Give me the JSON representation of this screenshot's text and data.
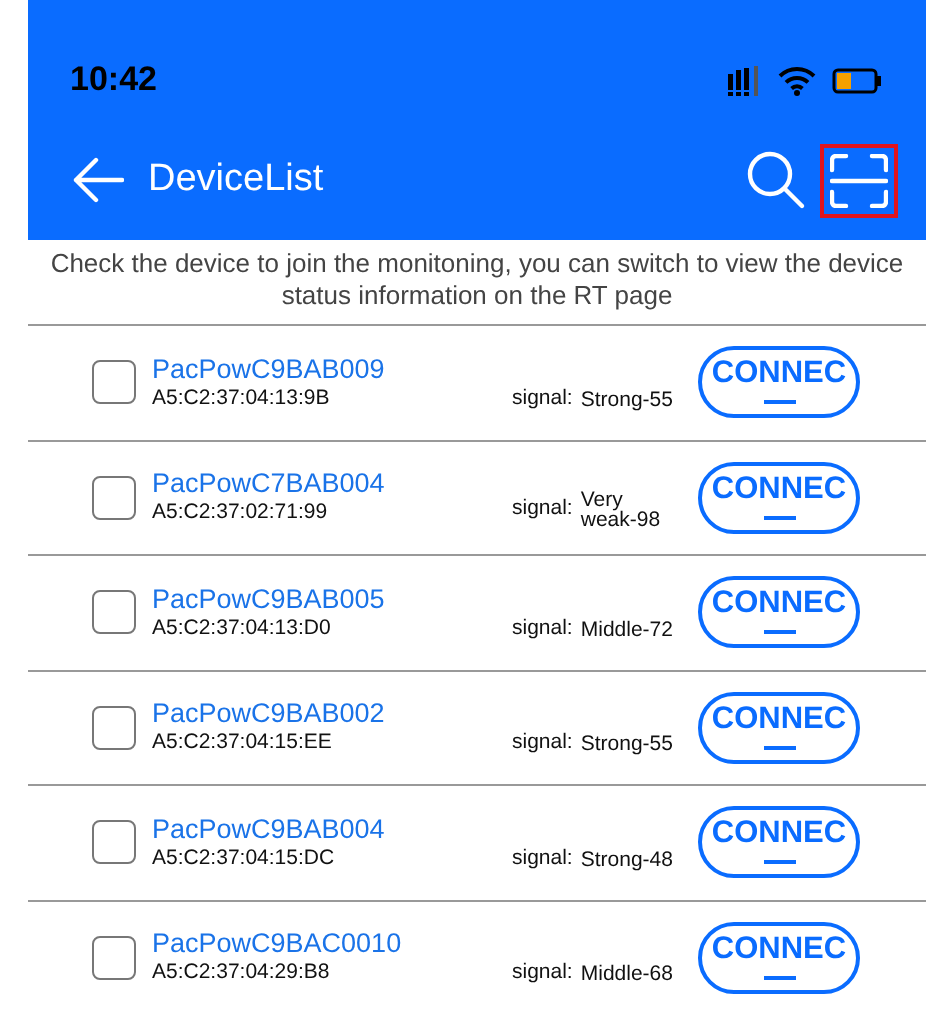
{
  "status_bar": {
    "time": "10:42"
  },
  "toolbar": {
    "title": "DeviceList",
    "scan_highlighted": true
  },
  "hint": "Check the device to join the monitoning, you can switch to view the device status information on the RT page",
  "devices": [
    {
      "name": "PacPowC9BAB009",
      "mac": "A5:C2:37:04:13:9B",
      "signal_label": "signal:",
      "signal": "Strong-55",
      "checked": false,
      "button": "CONNEC"
    },
    {
      "name": "PacPowC7BAB004",
      "mac": "A5:C2:37:02:71:99",
      "signal_label": "signal:",
      "signal": "Very weak-98",
      "checked": false,
      "button": "CONNEC"
    },
    {
      "name": "PacPowC9BAB005",
      "mac": "A5:C2:37:04:13:D0",
      "signal_label": "signal:",
      "signal": "Middle-72",
      "checked": false,
      "button": "CONNEC"
    },
    {
      "name": "PacPowC9BAB002",
      "mac": "A5:C2:37:04:15:EE",
      "signal_label": "signal:",
      "signal": "Strong-55",
      "checked": false,
      "button": "CONNEC"
    },
    {
      "name": "PacPowC9BAB004",
      "mac": "A5:C2:37:04:15:DC",
      "signal_label": "signal:",
      "signal": "Strong-48",
      "checked": false,
      "button": "CONNEC"
    },
    {
      "name": "PacPowC9BAC0010",
      "mac": "A5:C2:37:04:29:B8",
      "signal_label": "signal:",
      "signal": "Middle-68",
      "checked": false,
      "button": "CONNEC"
    }
  ]
}
